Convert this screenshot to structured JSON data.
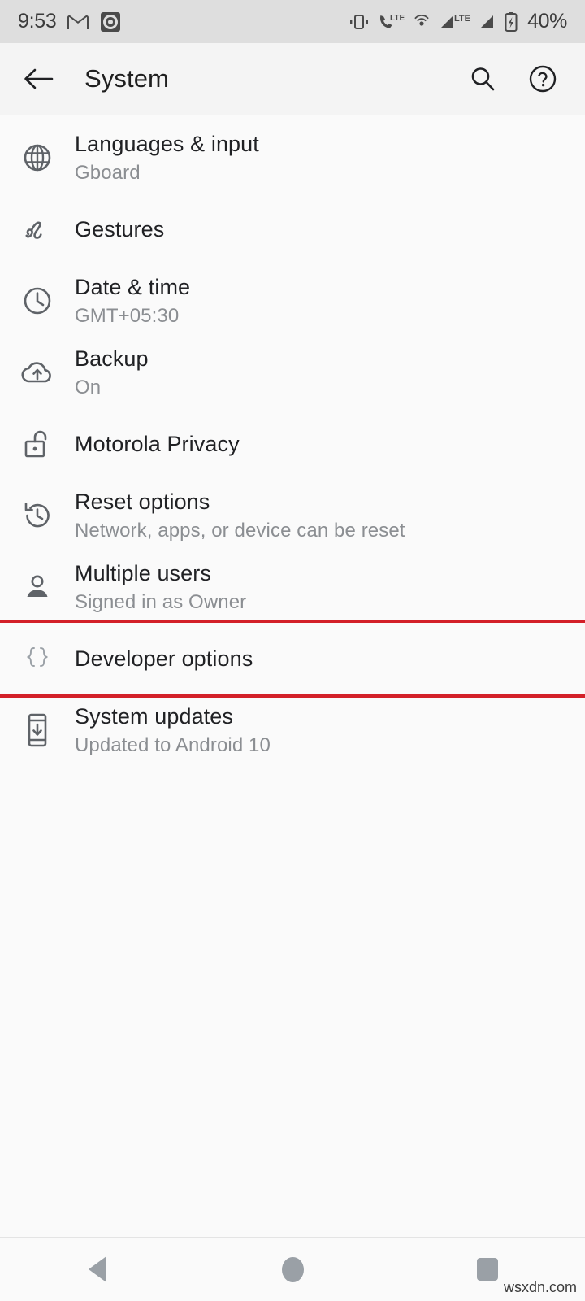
{
  "status_bar": {
    "clock": "9:53",
    "battery_percent": "40%",
    "icons": [
      "gmail-icon",
      "screen-record-icon",
      "vibrate-icon",
      "phone-lte-icon",
      "hotspot-icon",
      "signal-lte-icon",
      "signal-icon",
      "battery-charging-icon"
    ],
    "background_color": "#dedede"
  },
  "app_bar": {
    "title": "System",
    "back_icon": "arrow-back-icon",
    "search_icon": "search-icon",
    "help_icon": "help-circle-icon"
  },
  "list": {
    "items": [
      {
        "icon": "language-globe-icon",
        "title": "Languages & input",
        "subtitle": "Gboard",
        "highlighted": false
      },
      {
        "icon": "gestures-icon",
        "title": "Gestures",
        "subtitle": "",
        "highlighted": false
      },
      {
        "icon": "clock-icon",
        "title": "Date & time",
        "subtitle": "GMT+05:30",
        "highlighted": false
      },
      {
        "icon": "cloud-upload-icon",
        "title": "Backup",
        "subtitle": "On",
        "highlighted": false
      },
      {
        "icon": "unlock-icon",
        "title": "Motorola Privacy",
        "subtitle": "",
        "highlighted": false
      },
      {
        "icon": "restore-history-icon",
        "title": "Reset options",
        "subtitle": "Network, apps, or device can be reset",
        "highlighted": false
      },
      {
        "icon": "person-icon",
        "title": "Multiple users",
        "subtitle": "Signed in as Owner",
        "highlighted": false
      },
      {
        "icon": "braces-icon",
        "title": "Developer options",
        "subtitle": "",
        "highlighted": true
      },
      {
        "icon": "system-update-icon",
        "title": "System updates",
        "subtitle": "Updated to Android 10",
        "highlighted": false
      }
    ],
    "highlight_color": "#d32028"
  },
  "nav_bar": {
    "back_label": "Back",
    "home_label": "Home",
    "recents_label": "Recents"
  },
  "watermark": "wsxdn.com"
}
